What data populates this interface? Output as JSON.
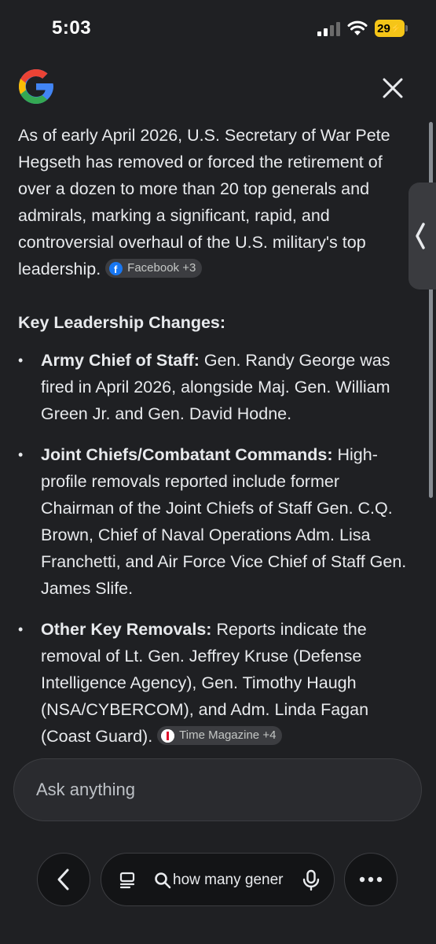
{
  "status_bar": {
    "time": "5:03",
    "battery": "29"
  },
  "answer": {
    "intro": "As of early April 2026, U.S. Secretary of War Pete Hegseth has removed or forced the retirement of over a dozen to more than 20 top generals and admirals, marking a significant, rapid, and controversial overhaul of the U.S. military's top leadership.",
    "intro_source_chip": "Facebook +3",
    "section_heading": "Key Leadership Changes:",
    "items": [
      {
        "term": "Army Chief of Staff:",
        "text": " Gen. Randy George was fired in April 2026, alongside Maj. Gen. William Green Jr. and Gen. David Hodne."
      },
      {
        "term": "Joint Chiefs/Combatant Commands:",
        "text": " High-profile removals reported include former Chairman of the Joint Chiefs of Staff Gen. C.Q. Brown, Chief of Naval Operations Adm. Lisa Franchetti, and Air Force Vice Chief of Staff Gen. James Slife."
      },
      {
        "term": "Other Key Removals:",
        "text": " Reports indicate the removal of Lt. Gen. Jeffrey Kruse (Defense Intelligence Agency), Gen. Timothy Haugh (NSA/CYBERCOM), and Adm. Linda Fagan (Coast Guard).",
        "source_chip": "Time Magazine +4"
      }
    ]
  },
  "ask_bar": {
    "placeholder": "Ask anything"
  },
  "bottom_nav": {
    "query": "how many gener"
  },
  "colors": {
    "background": "#1f2023",
    "chip_bg": "#3c3d41",
    "facebook": "#1877f2",
    "time_red": "#e0112b",
    "battery": "#f5c518"
  }
}
